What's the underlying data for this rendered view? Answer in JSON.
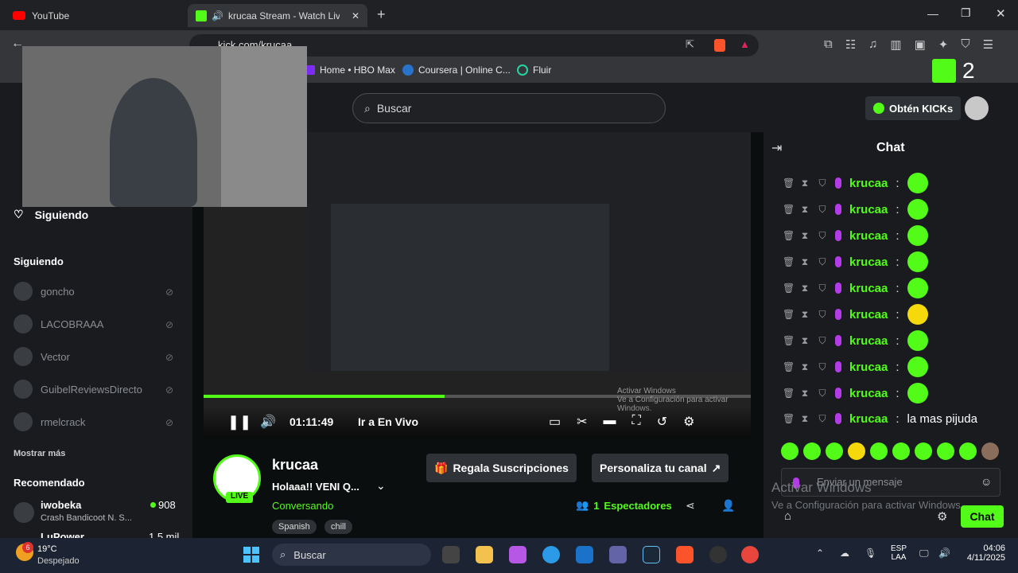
{
  "tabs": [
    {
      "label": "YouTube",
      "active": false
    },
    {
      "label": "krucaa Stream - Watch Live o",
      "active": true
    }
  ],
  "address": "kick.com/krucaa",
  "bookmarks": [
    "Home • HBO Max",
    "Coursera | Online C...",
    "Fluir"
  ],
  "overlay_counter": "2",
  "kick": {
    "search_placeholder": "Buscar",
    "get_kicks": "Obtén KICKs",
    "sidebar": {
      "following_top": "Siguiendo",
      "following_header": "Siguiendo",
      "following": [
        "goncho",
        "LACOBRAAA",
        "Vector",
        "GuibelReviewsDirecto",
        "rmelcrack"
      ],
      "show_more": "Mostrar más",
      "recommended_header": "Recomendado",
      "recommended": [
        {
          "name": "iwobeka",
          "game": "Crash Bandicoot N. S...",
          "viewers": "908"
        },
        {
          "name": "LuPower",
          "game": "",
          "viewers": "1,5 mil"
        }
      ]
    },
    "player": {
      "time": "01:11:49",
      "live_label": "Ir a En Vivo",
      "watermark_title": "Activar Windows",
      "watermark_sub": "Ve a Configuración para activar Windows."
    },
    "stream": {
      "name": "krucaa",
      "title": "Holaaa!! VENI Q...",
      "category": "Conversando",
      "live_badge": "LIVE",
      "tags": [
        "Spanish",
        "chill"
      ],
      "gift_subs": "Regala Suscripciones",
      "customize": "Personaliza tu canal",
      "viewers_count": "1",
      "viewers_label": "Espectadores"
    },
    "chat": {
      "title": "Chat",
      "username": "krucaa",
      "last_text": "la mas pijuda",
      "input_placeholder": "Enviar un mensaje",
      "send": "Chat",
      "watermark_title": "Activar Windows",
      "watermark_sub": "Ve a Configuración para activar Windows."
    }
  },
  "taskbar": {
    "weather_temp": "19°C",
    "weather_desc": "Despejado",
    "weather_badge": "6",
    "search": "Buscar",
    "lang": "ESP",
    "lang2": "LAA",
    "time": "04:06",
    "date": "4/11/2025"
  },
  "colors": {
    "accent": "#53fc18",
    "page_bg": "#0b0e0f",
    "panel": "#191b1f"
  }
}
